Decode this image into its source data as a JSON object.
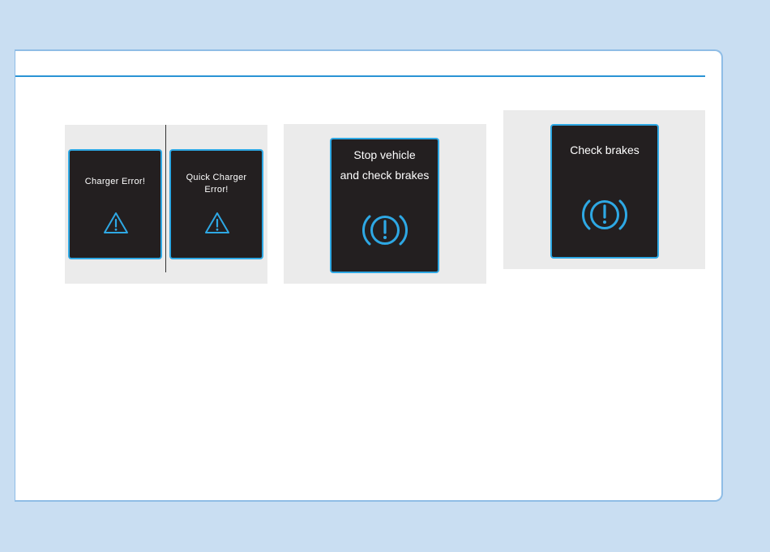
{
  "panels": [
    {
      "screens": [
        {
          "message": "Charger Error!",
          "icon": "warning-triangle-icon"
        },
        {
          "message_lines": [
            "Quick Charger",
            "Error!"
          ],
          "icon": "warning-triangle-icon"
        }
      ]
    },
    {
      "screens": [
        {
          "message_lines": [
            "Stop vehicle",
            "and check brakes"
          ],
          "icon": "brake-warning-icon"
        }
      ]
    },
    {
      "screens": [
        {
          "message": "Check brakes",
          "icon": "brake-warning-icon"
        }
      ]
    }
  ],
  "colors": {
    "page_background": "#c9def2",
    "accent": "#2ea8e4",
    "screen_background": "#231f20",
    "panel_background": "#ebebeb",
    "text": "#ffffff"
  }
}
